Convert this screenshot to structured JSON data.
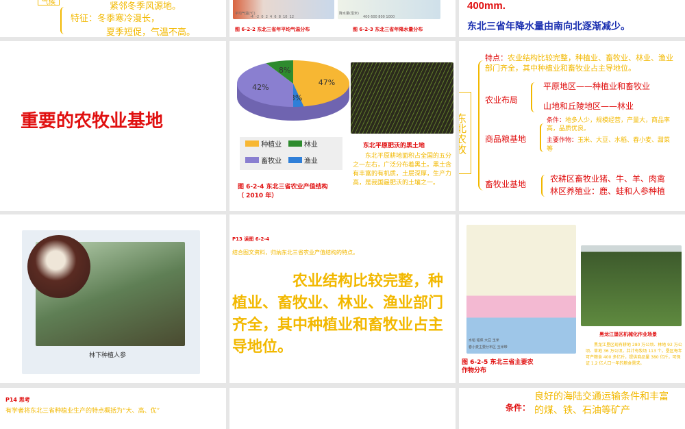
{
  "slides": [
    {
      "id": "climate",
      "box_label": "气候",
      "line1": "紧邻冬季风源地。",
      "feature_label": "特征：冬季寒冷漫长，",
      "feature_line2": "夏季短促，气温不高。"
    },
    {
      "id": "maps",
      "temp_legend": "平均气温(℃)",
      "temp_ticks": "-4  -2  0  2  4  6  8  10  12",
      "rain_legend": "降水量(毫米)",
      "rain_ticks": "400 600 800 1000",
      "caption1": "图 6-2-2  东北三省年平均气温分布",
      "caption2": "图 6-2-3  东北三省年降水量分布"
    },
    {
      "id": "precip",
      "line1": "400mm.",
      "line2": "东北三省年降水量由南向北逐渐减少。"
    },
    {
      "id": "title",
      "title": "重要的农牧业基地"
    },
    {
      "id": "structure",
      "caption": "图 6-2-4  东北三省农业产值结构",
      "caption_year": "（ 2010 年）",
      "photo_caption": "东北平原肥沃的黑土地",
      "photo_text": "东北平原耕地面积占全国的五分之一左右，广泛分布着黑土。黑土含有丰富的有机质，土层深厚，生产力高，是我国最肥沃的土壤之一。"
    },
    {
      "id": "summary",
      "vertical_title": "东北农牧",
      "feature_label": "特点：",
      "feature_text": "农业结构比较完整，种植业、畜牧业、林业、渔业部门齐全，其中种植业和畜牧业占主导地位。",
      "layout_label": "农业布局",
      "plain": "平原地区——种植业和畜牧业",
      "hill": "山地和丘陵地区——林业",
      "grain_label": "商品粮基地",
      "cond_label": "条件：",
      "cond_text": "地多人少，规模经营，产量大，商品率高，品质优良。",
      "crops_label": "主要作物：",
      "crops_text": "玉米、大豆、水稻、春小麦、甜菜等",
      "livestock_label": "畜牧业基地",
      "farm": "农耕区畜牧业猪、牛、羊、肉禽",
      "forest": "林区养殖业：鹿、蛙和人参种植"
    },
    {
      "id": "ginseng",
      "caption": "林下种植人参"
    },
    {
      "id": "question",
      "ref": "P13  读图 6-2-4",
      "prompt": "结合图文资料，归纳东北三省农业产值结构的特点。",
      "answer": "农业结构比较完整，种植业、畜牧业、林业、渔业部门齐全，其中种植业和畜牧业占主导地位。"
    },
    {
      "id": "crops",
      "map_legend": "水稻  甜菜  大豆  玉米",
      "map_legend2": "春小麦主要分布区  玉米带",
      "caption": "图 6-2-5  东北三省主要农作物分布",
      "photo_caption": "黑龙江垦区机械化作业场景",
      "photo_text": "黑龙江垦区现有耕地 280 万公顷、林地 92 万公顷、草地 36 万公顷，共计有牧场 113 个。垦区每年可产粮食 400 多亿斤，提供商品量 380 亿斤，可保证 1.2 亿人口一年的粮食需求。"
    },
    {
      "id": "think",
      "ref": "P14  思考",
      "text": "有学者将东北三省种植业生产的特点概括为“大、高、优”"
    },
    {
      "id": "blank"
    },
    {
      "id": "conditions",
      "label": "条件：",
      "text": "良好的海陆交通运输条件和丰富的煤、铁、石油等矿产"
    }
  ],
  "chart_data": {
    "type": "pie",
    "title": "东北三省农业产值结构（2010年）",
    "categories": [
      "种植业",
      "畜牧业",
      "林业",
      "渔业"
    ],
    "values": [
      47,
      42,
      8,
      3
    ],
    "labels": [
      "47%",
      "42%",
      "8%",
      "3%"
    ],
    "colors": [
      "#f7b733",
      "#8a7fd0",
      "#2e8b2e",
      "#2f7fd8"
    ]
  }
}
